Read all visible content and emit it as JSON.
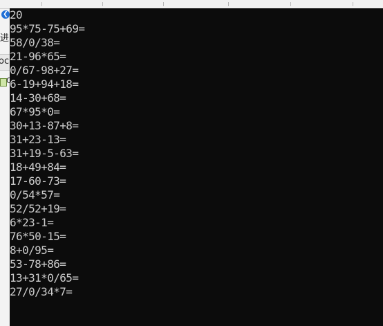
{
  "background_app": {
    "back_icon": "back-arrow-icon",
    "text_fragments": [
      "进",
      "oc",
      "Q"
    ]
  },
  "console": {
    "lines": [
      "20",
      "95*75-75+69=",
      "58/0/38=",
      "21-96*65=",
      "0/67-98+27=",
      "6-19+94+18=",
      "14-30+68=",
      "67*95*0=",
      "30+13-87+8=",
      "31+23-13=",
      "31+19-5-63=",
      "18+49+84=",
      "17-60-73=",
      "0/54*57=",
      "52/52+19=",
      "6*23-1=",
      "76*50-15=",
      "8+0/95=",
      "53-78+86=",
      "13+31*0/65=",
      "27/0/34*7="
    ],
    "colors": {
      "background": "#0c0c0c",
      "text": "#cccccc"
    }
  }
}
